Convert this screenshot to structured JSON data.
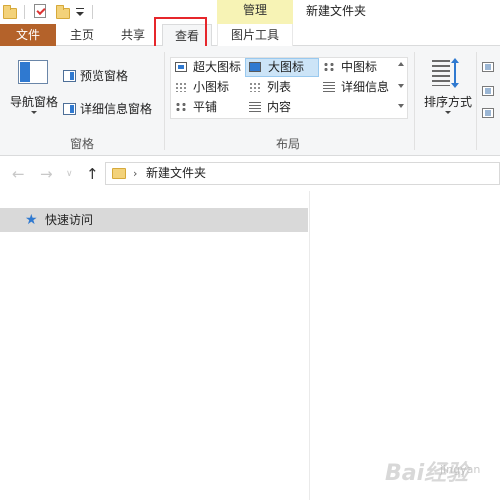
{
  "window": {
    "context_header": "管理",
    "title": "新建文件夹"
  },
  "tabs": {
    "file": "文件",
    "home": "主页",
    "share": "共享",
    "view": "查看",
    "picture_tools": "图片工具"
  },
  "ribbon": {
    "panes": {
      "navigation_pane": "导航窗格",
      "preview_pane": "预览窗格",
      "details_pane": "详细信息窗格",
      "group_label": "窗格"
    },
    "layout": {
      "extra_large_icons": "超大图标",
      "large_icons": "大图标",
      "medium_icons": "中图标",
      "small_icons": "小图标",
      "list": "列表",
      "details": "详细信息",
      "tiles": "平铺",
      "content": "内容",
      "selected": "大图标",
      "group_label": "布局"
    },
    "current_view": {
      "sort_by": "排序方式"
    }
  },
  "address_bar": {
    "path": "新建文件夹"
  },
  "navigation": {
    "quick_access": "快速访问"
  },
  "watermark": {
    "brand": "Bai经验",
    "sub": "jingyan"
  },
  "colors": {
    "file_tab": "#b4622a",
    "context_tab": "#f7f3b5",
    "highlight_box": "#e6262b",
    "selection": "#cce4f7",
    "accent": "#2f79d0"
  }
}
